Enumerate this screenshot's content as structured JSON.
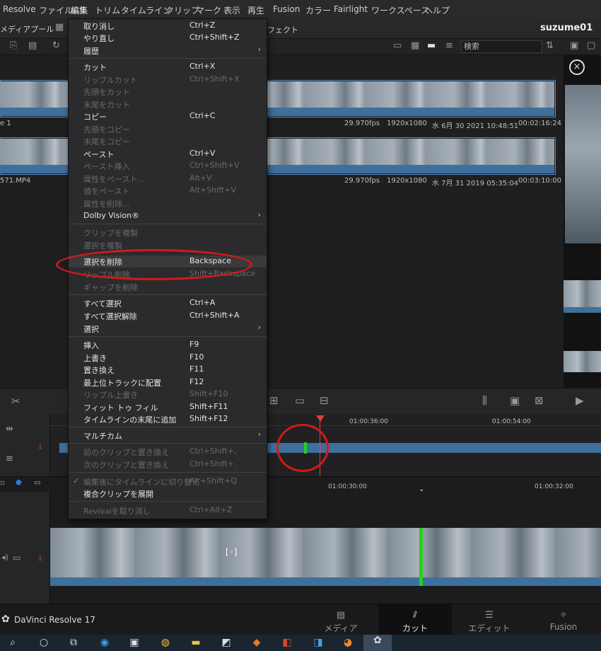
{
  "menubar": {
    "items": [
      "Resolve",
      "ファイル",
      "編集",
      "トリム",
      "タイムライン",
      "クリップ",
      "マーク",
      "表示",
      "再生",
      "Fusion",
      "カラー",
      "Fairlight",
      "ワークスペース",
      "ヘルプ"
    ],
    "active_index": 2
  },
  "toolbar": {
    "media_pool": "メディアプール",
    "effects": "フェクト",
    "project": "suzume01",
    "search_placeholder": "検索"
  },
  "clips": [
    {
      "name": "e 1",
      "fps": "29.970fps",
      "res": "1920x1080",
      "date": "水 6月 30 2021 10:48:51",
      "duration": "00:02:16:24"
    },
    {
      "name": "571.MP4",
      "fps": "29.970fps",
      "res": "1920x1080",
      "date": "水 7月 31 2019 05:35:04",
      "duration": "00:03:10:00"
    }
  ],
  "menu": {
    "rows": [
      {
        "label": "取り消し",
        "shortcut": "Ctrl+Z",
        "disabled": false
      },
      {
        "label": "やり直し",
        "shortcut": "Ctrl+Shift+Z",
        "disabled": false
      },
      {
        "label": "履歴",
        "shortcut": "",
        "disabled": false,
        "submenu": true
      },
      {
        "label": "カット",
        "shortcut": "Ctrl+X",
        "disabled": false
      },
      {
        "label": "リップルカット",
        "shortcut": "Ctrl+Shift+X",
        "disabled": true
      },
      {
        "label": "先頭をカット",
        "shortcut": "",
        "disabled": true
      },
      {
        "label": "末尾をカット",
        "shortcut": "",
        "disabled": true
      },
      {
        "label": "コピー",
        "shortcut": "Ctrl+C",
        "disabled": false
      },
      {
        "label": "先頭をコピー",
        "shortcut": "",
        "disabled": true
      },
      {
        "label": "末尾をコピー",
        "shortcut": "",
        "disabled": true
      },
      {
        "label": "ペースト",
        "shortcut": "Ctrl+V",
        "disabled": false
      },
      {
        "label": "ペースト挿入",
        "shortcut": "Ctrl+Shift+V",
        "disabled": true
      },
      {
        "label": "属性をペースト...",
        "shortcut": "Alt+V",
        "disabled": true
      },
      {
        "label": "値をペースト",
        "shortcut": "Alt+Shift+V",
        "disabled": true
      },
      {
        "label": "属性を削除...",
        "shortcut": "",
        "disabled": true
      },
      {
        "label": "Dolby Vision®",
        "shortcut": "",
        "disabled": false,
        "submenu": true
      },
      {
        "label": "クリップを複製",
        "shortcut": "",
        "disabled": true
      },
      {
        "label": "選択を複製",
        "shortcut": "",
        "disabled": true
      },
      {
        "label": "選択を削除",
        "shortcut": "Backspace",
        "disabled": false,
        "highlight": true
      },
      {
        "label": "リップル削除",
        "shortcut": "Shift+Backspace",
        "disabled": true
      },
      {
        "label": "ギャップを削除",
        "shortcut": "",
        "disabled": true
      },
      {
        "label": "すべて選択",
        "shortcut": "Ctrl+A",
        "disabled": false
      },
      {
        "label": "すべて選択解除",
        "shortcut": "Ctrl+Shift+A",
        "disabled": false
      },
      {
        "label": "選択",
        "shortcut": "",
        "disabled": false,
        "submenu": true
      },
      {
        "label": "挿入",
        "shortcut": "F9",
        "disabled": false
      },
      {
        "label": "上書き",
        "shortcut": "F10",
        "disabled": false
      },
      {
        "label": "置き換え",
        "shortcut": "F11",
        "disabled": false
      },
      {
        "label": "最上位トラックに配置",
        "shortcut": "F12",
        "disabled": false
      },
      {
        "label": "リップル上書き",
        "shortcut": "Shift+F10",
        "disabled": true
      },
      {
        "label": "フィット トゥ フィル",
        "shortcut": "Shift+F11",
        "disabled": false
      },
      {
        "label": "タイムラインの末尾に追加",
        "shortcut": "Shift+F12",
        "disabled": false
      },
      {
        "label": "マルチカム",
        "shortcut": "",
        "disabled": false,
        "submenu": true
      },
      {
        "label": "前のクリップと置き換え",
        "shortcut": "Ctrl+Shift+,",
        "disabled": true
      },
      {
        "label": "次のクリップと置き換え",
        "shortcut": "Ctrl+Shift+.",
        "disabled": true
      },
      {
        "label": "編集後にタイムラインに切り替え",
        "shortcut": "Alt+Shift+Q",
        "disabled": true,
        "checked": true
      },
      {
        "label": "複合クリップを展開",
        "shortcut": "",
        "disabled": false
      },
      {
        "label": "Revivalを取り消し",
        "shortcut": "Ctrl+Alt+Z",
        "disabled": true
      }
    ]
  },
  "timeline": {
    "upper_timecodes": [
      "01:00:36:00",
      "01:00:54:00"
    ],
    "lower_timecodes": [
      "01:00:30:00",
      "01:00:32:00"
    ],
    "track_number": "1"
  },
  "pages": [
    {
      "label": "メディア",
      "icon": "media-page-icon"
    },
    {
      "label": "カット",
      "icon": "cut-page-icon",
      "active": true
    },
    {
      "label": "エディット",
      "icon": "edit-page-icon"
    },
    {
      "label": "Fusion",
      "icon": "fusion-page-icon"
    }
  ],
  "app_name": "DaVinci Resolve 17",
  "colors": {
    "accent_red": "#d11a1a",
    "clip_blue": "#3f6f9c",
    "playhead": "#e04040",
    "marker_green": "#22d122"
  }
}
